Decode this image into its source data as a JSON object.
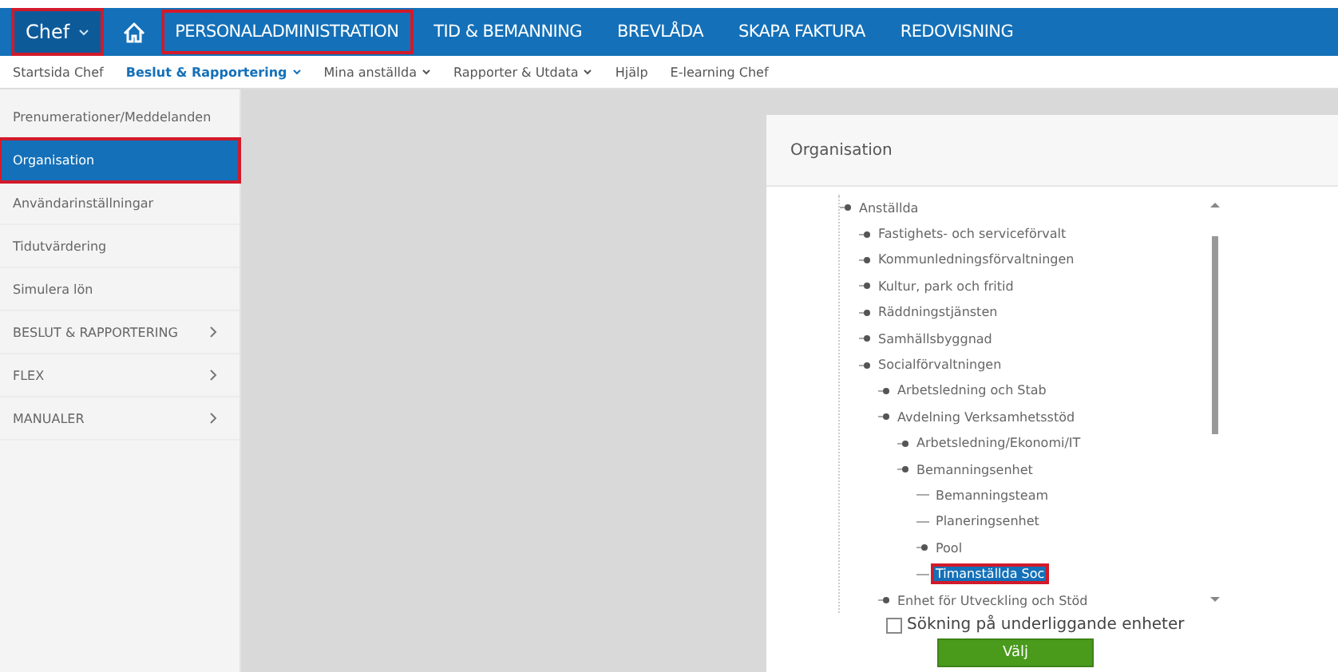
{
  "top_nav": {
    "role": {
      "label": "Chef",
      "highlighted": true
    },
    "items": [
      {
        "label": "PERSONALADMINISTRATION",
        "highlighted": true
      },
      {
        "label": "TID & BEMANNING",
        "highlighted": false
      },
      {
        "label": "BREVLÅDA",
        "highlighted": false
      },
      {
        "label": "SKAPA FAKTURA",
        "highlighted": false
      },
      {
        "label": "REDOVISNING",
        "highlighted": false
      }
    ]
  },
  "sub_nav": [
    {
      "label": "Startsida Chef",
      "selected": false,
      "has_menu": false
    },
    {
      "label": "Beslut & Rapportering",
      "selected": true,
      "has_menu": true
    },
    {
      "label": "Mina anställda",
      "selected": false,
      "has_menu": true
    },
    {
      "label": "Rapporter & Utdata",
      "selected": false,
      "has_menu": true
    },
    {
      "label": "Hjälp",
      "selected": false,
      "has_menu": false
    },
    {
      "label": "E-learning Chef",
      "selected": false,
      "has_menu": false
    }
  ],
  "sidebar": {
    "items": [
      {
        "label": "Prenumerationer/Meddelanden",
        "selected": false,
        "highlighted": false,
        "has_submenu": false
      },
      {
        "label": "Organisation",
        "selected": true,
        "highlighted": true,
        "has_submenu": false
      },
      {
        "label": "Användarinställningar",
        "selected": false,
        "highlighted": false,
        "has_submenu": false
      },
      {
        "label": "Tidutvärdering",
        "selected": false,
        "highlighted": false,
        "has_submenu": false
      },
      {
        "label": "Simulera lön",
        "selected": false,
        "highlighted": false,
        "has_submenu": false
      },
      {
        "label": "BESLUT & RAPPORTERING",
        "selected": false,
        "highlighted": false,
        "has_submenu": true
      },
      {
        "label": "FLEX",
        "selected": false,
        "highlighted": false,
        "has_submenu": true
      },
      {
        "label": "MANUALER",
        "selected": false,
        "highlighted": false,
        "has_submenu": true
      }
    ]
  },
  "dialog": {
    "title": "Organisation",
    "tree": [
      {
        "label": "Anställda",
        "kind": "node",
        "selected": false,
        "highlighted": false,
        "children": [
          {
            "label": "Fastighets- och serviceförvalt",
            "kind": "node",
            "selected": false,
            "highlighted": false
          },
          {
            "label": "Kommunledningsförvaltningen",
            "kind": "node",
            "selected": false,
            "highlighted": false
          },
          {
            "label": "Kultur, park och fritid",
            "kind": "node",
            "selected": false,
            "highlighted": false
          },
          {
            "label": "Räddningstjänsten",
            "kind": "node",
            "selected": false,
            "highlighted": false
          },
          {
            "label": "Samhällsbyggnad",
            "kind": "node",
            "selected": false,
            "highlighted": false
          },
          {
            "label": "Socialförvaltningen",
            "kind": "node",
            "selected": false,
            "highlighted": false,
            "children": [
              {
                "label": "Arbetsledning och Stab",
                "kind": "node",
                "selected": false,
                "highlighted": false
              },
              {
                "label": "Avdelning Verksamhetsstöd",
                "kind": "node",
                "selected": false,
                "highlighted": false,
                "children": [
                  {
                    "label": "Arbetsledning/Ekonomi/IT",
                    "kind": "node",
                    "selected": false,
                    "highlighted": false
                  },
                  {
                    "label": "Bemanningsenhet",
                    "kind": "node",
                    "selected": false,
                    "highlighted": false,
                    "children": [
                      {
                        "label": "Bemanningsteam",
                        "kind": "leaf",
                        "selected": false,
                        "highlighted": false
                      },
                      {
                        "label": "Planeringsenhet",
                        "kind": "leaf",
                        "selected": false,
                        "highlighted": false
                      },
                      {
                        "label": "Pool",
                        "kind": "node",
                        "selected": false,
                        "highlighted": false
                      },
                      {
                        "label": "Timanställda Soc",
                        "kind": "leaf",
                        "selected": true,
                        "highlighted": true
                      }
                    ]
                  }
                ]
              },
              {
                "label": "Enhet för Utveckling och Stöd",
                "kind": "node",
                "selected": false,
                "highlighted": false
              }
            ]
          }
        ]
      }
    ],
    "subunit_search": {
      "label": "Sökning på underliggande enheter",
      "checked": false
    },
    "choose_button": "Välj"
  }
}
